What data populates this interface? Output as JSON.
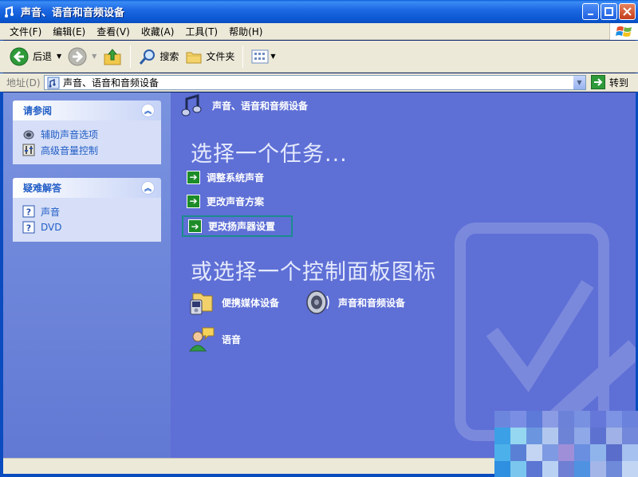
{
  "window": {
    "title": "声音、语音和音频设备",
    "minimize_icon": "minimize-icon",
    "maximize_icon": "maximize-icon",
    "close_icon": "close-icon"
  },
  "menubar": {
    "items": [
      "文件(F)",
      "编辑(E)",
      "查看(V)",
      "收藏(A)",
      "工具(T)",
      "帮助(H)"
    ]
  },
  "toolbar": {
    "back_label": "后退",
    "search_label": "搜索",
    "folders_label": "文件夹"
  },
  "address": {
    "label": "地址(D)",
    "value": "声音、语音和音频设备",
    "go_label": "转到"
  },
  "sidebar": {
    "see_also": {
      "title": "请参阅",
      "links": [
        "辅助声音选项",
        "高级音量控制"
      ]
    },
    "troubleshoot": {
      "title": "疑难解答",
      "links": [
        "声音",
        "DVD"
      ]
    }
  },
  "main": {
    "header_title": "声音、语音和音频设备",
    "pick_task_title": "选择一个任务...",
    "tasks": [
      "调整系统声音",
      "更改声音方案",
      "更改扬声器设置"
    ],
    "highlighted_task_index": 2,
    "pick_icon_title": "或选择一个控制面板图标",
    "icons": [
      "便携媒体设备",
      "声音和音频设备",
      "语音"
    ]
  },
  "colors": {
    "title_bar": "#0b57d0",
    "sidebar_bg": "#6c84da",
    "main_bg": "#5e6fd6",
    "link": "#215dc6",
    "task_arrow": "#1d8c28",
    "highlight_border": "#1c8b8d"
  }
}
